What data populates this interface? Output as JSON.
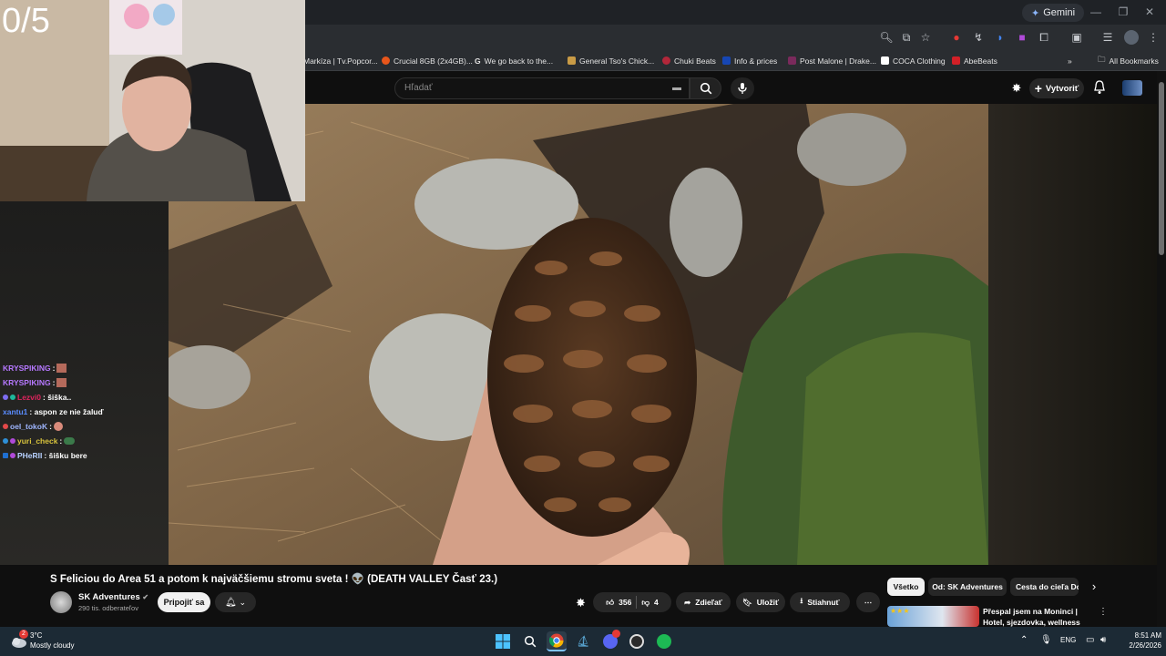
{
  "overlay": {
    "counter": "0/5"
  },
  "browser": {
    "gemini_label": "Gemini",
    "bookmarks": [
      {
        "label": "Markíza | Tv.Popcor...",
        "color": "#f29b38"
      },
      {
        "label": "Crucial 8GB (2x4GB)...",
        "color": "#e8561b"
      },
      {
        "label": "We go back to the...",
        "color": "#ffffff"
      },
      {
        "label": "General Tso's Chick...",
        "color": "#c99b46"
      },
      {
        "label": "Chuki Beats",
        "color": "#b2273a"
      },
      {
        "label": "Info & prices",
        "color": "#1646b4"
      },
      {
        "label": "Post Malone | Drake...",
        "color": "#7a2a5c"
      },
      {
        "label": "COCA Clothing",
        "color": "#ffffff"
      },
      {
        "label": "AbeBeats",
        "color": "#d32027"
      }
    ],
    "all_bookmarks": "All Bookmarks"
  },
  "youtube": {
    "search_placeholder": "Hľadať",
    "create_label": "Vytvoriť"
  },
  "chat": [
    {
      "user": "KRYSPIKING",
      "msg": ":",
      "color": "#b678ff"
    },
    {
      "user": "KRYSPIKING",
      "msg": ":",
      "color": "#b678ff"
    },
    {
      "user": "Lezvi0",
      "msg": ": šiška..",
      "color": "#e0245e"
    },
    {
      "user": "xantu1",
      "msg": ": aspon ze nie žaluď",
      "color": "#5a8cff"
    },
    {
      "user": "oel_tokoK",
      "msg": ":",
      "color": "#9fb6ff"
    },
    {
      "user": "yuri_check",
      "msg": ":",
      "color": "#d8c33c"
    },
    {
      "user": "PHeRII",
      "msg": ": šišku bere",
      "color": "#b7d0ff"
    }
  ],
  "video": {
    "title": "S Feliciou do Area 51 a potom k najväčšiemu stromu sveta ! 👽 (DEATH VALLEY Časť 23.)",
    "channel": "SK Adventures",
    "subscribers": "290 tis. odberateľov",
    "join_label": "Pripojiť sa",
    "likes": "356",
    "dislikes": "4",
    "share_label": "Zdieľať",
    "save_label": "Uložiť",
    "download_label": "Stiahnuť"
  },
  "sidebar": {
    "chips": [
      "Všetko",
      "Od: SK Adventures",
      "Cesta do cieľa Do"
    ],
    "recommendation_title": "Přespal jsem na Moninci | Hotel, sjezdovka, wellness"
  },
  "taskbar": {
    "weather_temp": "3°C",
    "weather_desc": "Mostly cloudy",
    "weather_badge": "2",
    "lang": "ENG",
    "time": "8:51 AM",
    "date": "2/26/2026"
  }
}
